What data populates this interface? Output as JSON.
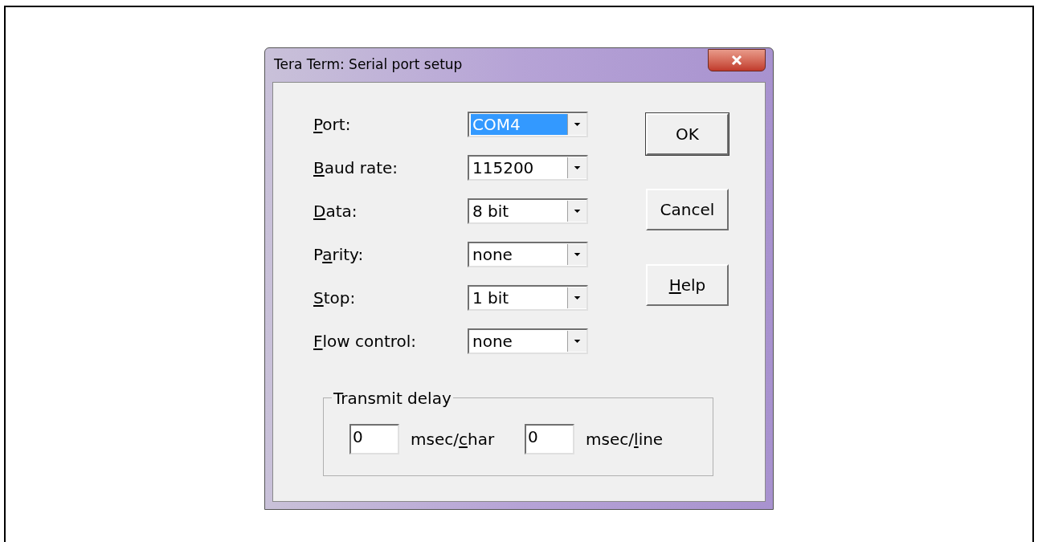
{
  "window": {
    "title": "Tera Term: Serial port setup"
  },
  "fields": [
    {
      "label": {
        "key": "P",
        "post": "ort:"
      },
      "value": "COM4",
      "focused": true
    },
    {
      "label": {
        "key": "B",
        "post": "aud rate:"
      },
      "value": "115200",
      "focused": false
    },
    {
      "label": {
        "key": "D",
        "post": "ata:"
      },
      "value": "8 bit",
      "focused": false
    },
    {
      "label": {
        "pre": "P",
        "key": "a",
        "post": "rity:"
      },
      "value": "none",
      "focused": false
    },
    {
      "label": {
        "key": "S",
        "post": "top:"
      },
      "value": "1 bit",
      "focused": false
    },
    {
      "label": {
        "key": "F",
        "post": "low control:"
      },
      "value": "none",
      "focused": false
    }
  ],
  "buttons": [
    {
      "label": {
        "post": "OK"
      },
      "default": true
    },
    {
      "label": {
        "post": "Cancel"
      },
      "default": false
    },
    {
      "label": {
        "key": "H",
        "post": "elp"
      },
      "default": false
    }
  ],
  "transmit_delay": {
    "title": "Transmit delay",
    "inputs": [
      {
        "value": "0",
        "unit": {
          "pre": "msec/",
          "key": "c",
          "post": "har"
        }
      },
      {
        "value": "0",
        "unit": {
          "pre": "msec/",
          "key": "l",
          "post": "ine"
        }
      }
    ]
  }
}
